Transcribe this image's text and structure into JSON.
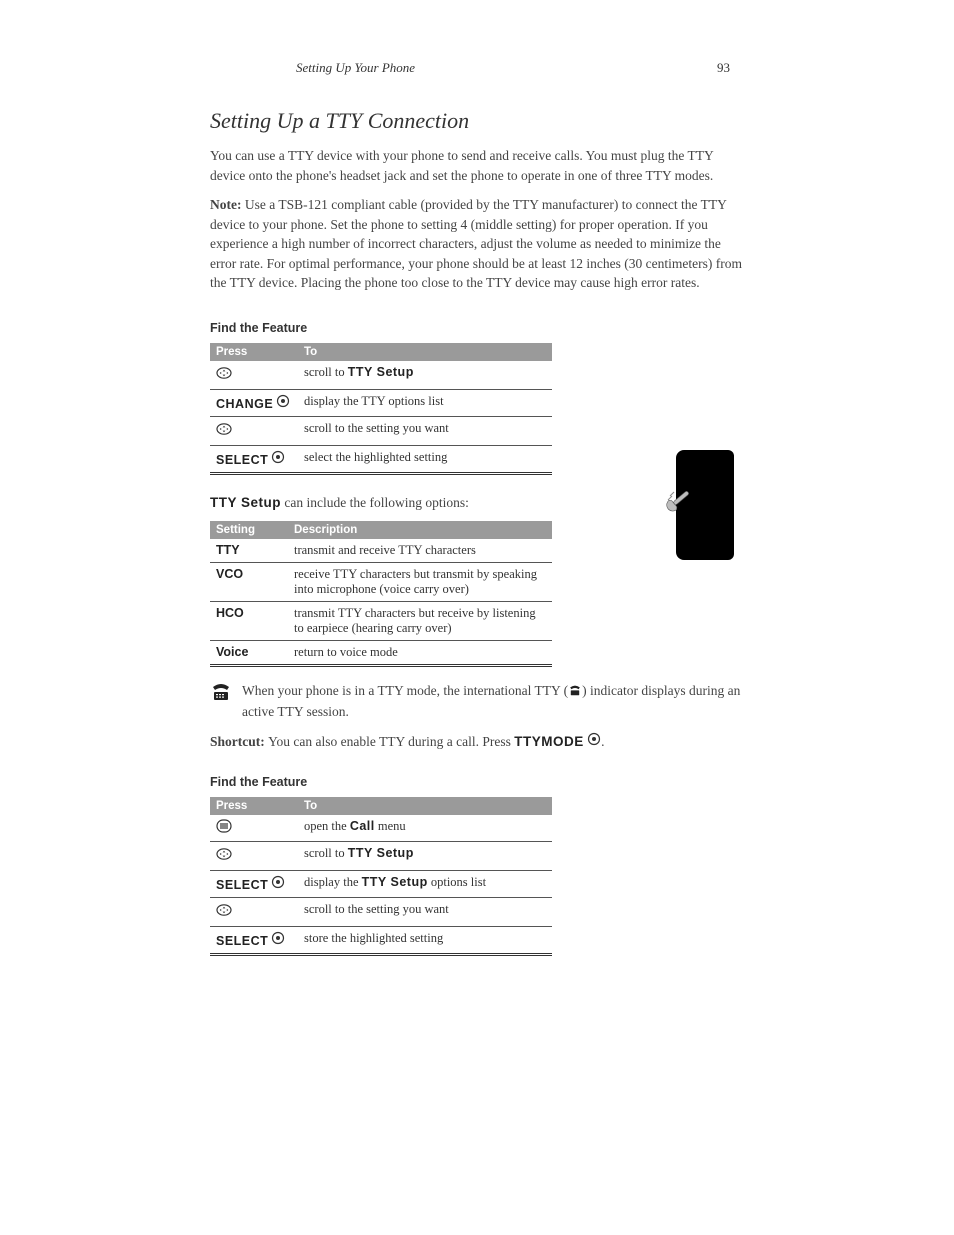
{
  "page": {
    "section_header": "Setting Up Your Phone",
    "page_number": "93"
  },
  "title": "Setting Up a TTY Connection",
  "intro": "You can use a TTY device with your phone to send and receive calls. You must plug the TTY device onto the phone's headset jack and set the phone to operate in one of three TTY modes.",
  "note_prefix": "Note: ",
  "note_body": "Use a TSB-121 compliant cable (provided by the TTY manufacturer) to connect the TTY device to your phone. Set the phone to setting 4 (middle setting) for proper operation. If you experience a high number of incorrect characters, adjust the volume as needed to minimize the error rate. For optimal performance, your phone should be at least 12 inches (30 centimeters) from the TTY device. Placing the phone too close to the TTY device may cause high error rates.",
  "find_feature": "Find the Feature",
  "steps1": {
    "headers": {
      "press": "Press",
      "to": "To"
    },
    "rows": [
      {
        "press_icon": "dpad",
        "press_text": "",
        "to_prefix": "scroll to ",
        "to_bold": "TTY Setup",
        "to_suffix": ""
      },
      {
        "press_icon": "",
        "press_bold": "CHANGE",
        "press_suffix_icon": "center",
        "to": "display the TTY options list"
      },
      {
        "press_icon": "dpad",
        "press_text": "",
        "to": "scroll to the setting you want"
      },
      {
        "press_icon": "",
        "press_bold": "SELECT",
        "press_suffix_icon": "center",
        "to": "select the highlighted setting"
      }
    ]
  },
  "options_intro_prefix": "",
  "options_intro_bold": "TTY Setup",
  "options_intro_suffix": " can include the following options:",
  "options": {
    "headers": {
      "setting": "Setting",
      "description": "Description"
    },
    "rows": [
      {
        "setting": "TTY",
        "description": "transmit and receive TTY characters"
      },
      {
        "setting": "VCO",
        "description": "receive TTY characters but transmit by speaking into microphone (voice carry over)"
      },
      {
        "setting": "HCO",
        "description": "transmit TTY characters but receive by listening to earpiece (hearing carry over)"
      },
      {
        "setting": "Voice",
        "description": "return to voice mode"
      }
    ]
  },
  "indicator_text_before": "When your phone is in a TTY mode, the international TTY (",
  "indicator_text_after": ") indicator displays during an active TTY session.",
  "shortcut_prefix": "Shortcut: ",
  "shortcut_body_before": "You can also enable TTY during a call. Press ",
  "shortcut_bold": "TTYMODE",
  "shortcut_body_after": ".",
  "steps2": {
    "headers": {
      "press": "Press",
      "to": "To"
    },
    "rows": [
      {
        "press_icon": "menukey",
        "press_text": "",
        "to_prefix": "open the ",
        "to_bold": "Call",
        "to_suffix": " menu"
      },
      {
        "press_icon": "dpad",
        "press_text": "",
        "to_prefix": "scroll to ",
        "to_bold": "TTY Setup",
        "to_suffix": ""
      },
      {
        "press_icon": "",
        "press_bold": "SELECT",
        "press_suffix_icon": "center",
        "to_prefix": "display the ",
        "to_bold": "TTY Setup",
        "to_suffix": " options list"
      },
      {
        "press_icon": "dpad",
        "press_text": "",
        "to": "scroll to the setting you want"
      },
      {
        "press_icon": "",
        "press_bold": "SELECT",
        "press_suffix_icon": "center",
        "to": "store the highlighted setting"
      }
    ]
  }
}
